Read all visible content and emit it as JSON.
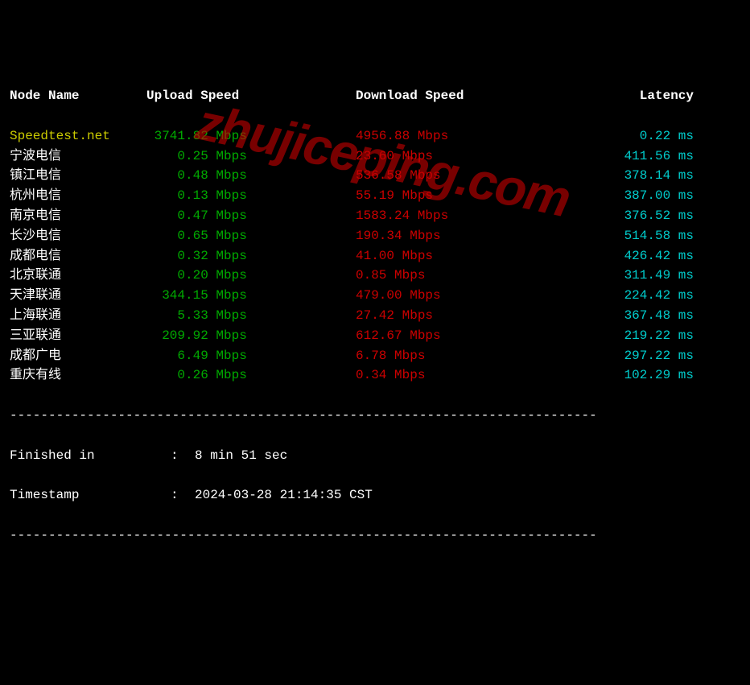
{
  "headers": {
    "node": "Node Name",
    "upload": "Upload Speed",
    "download": "Download Speed",
    "latency": "Latency"
  },
  "rows": [
    {
      "node": "Speedtest.net",
      "node_color": "yellow",
      "up": "3741.82 Mbps",
      "down": "4956.88 Mbps",
      "lat": "0.22 ms"
    },
    {
      "node": "宁波电信",
      "node_color": "white",
      "up": "0.25 Mbps",
      "down": "23.60 Mbps",
      "lat": "411.56 ms"
    },
    {
      "node": "镇江电信",
      "node_color": "white",
      "up": "0.48 Mbps",
      "down": "536.58 Mbps",
      "lat": "378.14 ms"
    },
    {
      "node": "杭州电信",
      "node_color": "white",
      "up": "0.13 Mbps",
      "down": "55.19 Mbps",
      "lat": "387.00 ms"
    },
    {
      "node": "南京电信",
      "node_color": "white",
      "up": "0.47 Mbps",
      "down": "1583.24 Mbps",
      "lat": "376.52 ms"
    },
    {
      "node": "长沙电信",
      "node_color": "white",
      "up": "0.65 Mbps",
      "down": "190.34 Mbps",
      "lat": "514.58 ms"
    },
    {
      "node": "成都电信",
      "node_color": "white",
      "up": "0.32 Mbps",
      "down": "41.00 Mbps",
      "lat": "426.42 ms"
    },
    {
      "node": "北京联通",
      "node_color": "white",
      "up": "0.20 Mbps",
      "down": "0.85 Mbps",
      "lat": "311.49 ms"
    },
    {
      "node": "天津联通",
      "node_color": "white",
      "up": "344.15 Mbps",
      "down": "479.00 Mbps",
      "lat": "224.42 ms"
    },
    {
      "node": "上海联通",
      "node_color": "white",
      "up": "5.33 Mbps",
      "down": "27.42 Mbps",
      "lat": "367.48 ms"
    },
    {
      "node": "三亚联通",
      "node_color": "white",
      "up": "209.92 Mbps",
      "down": "612.67 Mbps",
      "lat": "219.22 ms"
    },
    {
      "node": "成都广电",
      "node_color": "white",
      "up": "6.49 Mbps",
      "down": "6.78 Mbps",
      "lat": "297.22 ms"
    },
    {
      "node": "重庆有线",
      "node_color": "white",
      "up": "0.26 Mbps",
      "down": "0.34 Mbps",
      "lat": "102.29 ms"
    }
  ],
  "separator": "----------------------------------------------------------------------------",
  "footer": {
    "finished_label": "Finished in",
    "finished_value": "8 min 51 sec",
    "timestamp_label": "Timestamp",
    "timestamp_value": "2024-03-28 21:14:35 CST",
    "colon": ":"
  },
  "watermark": "zhujiceping.com"
}
